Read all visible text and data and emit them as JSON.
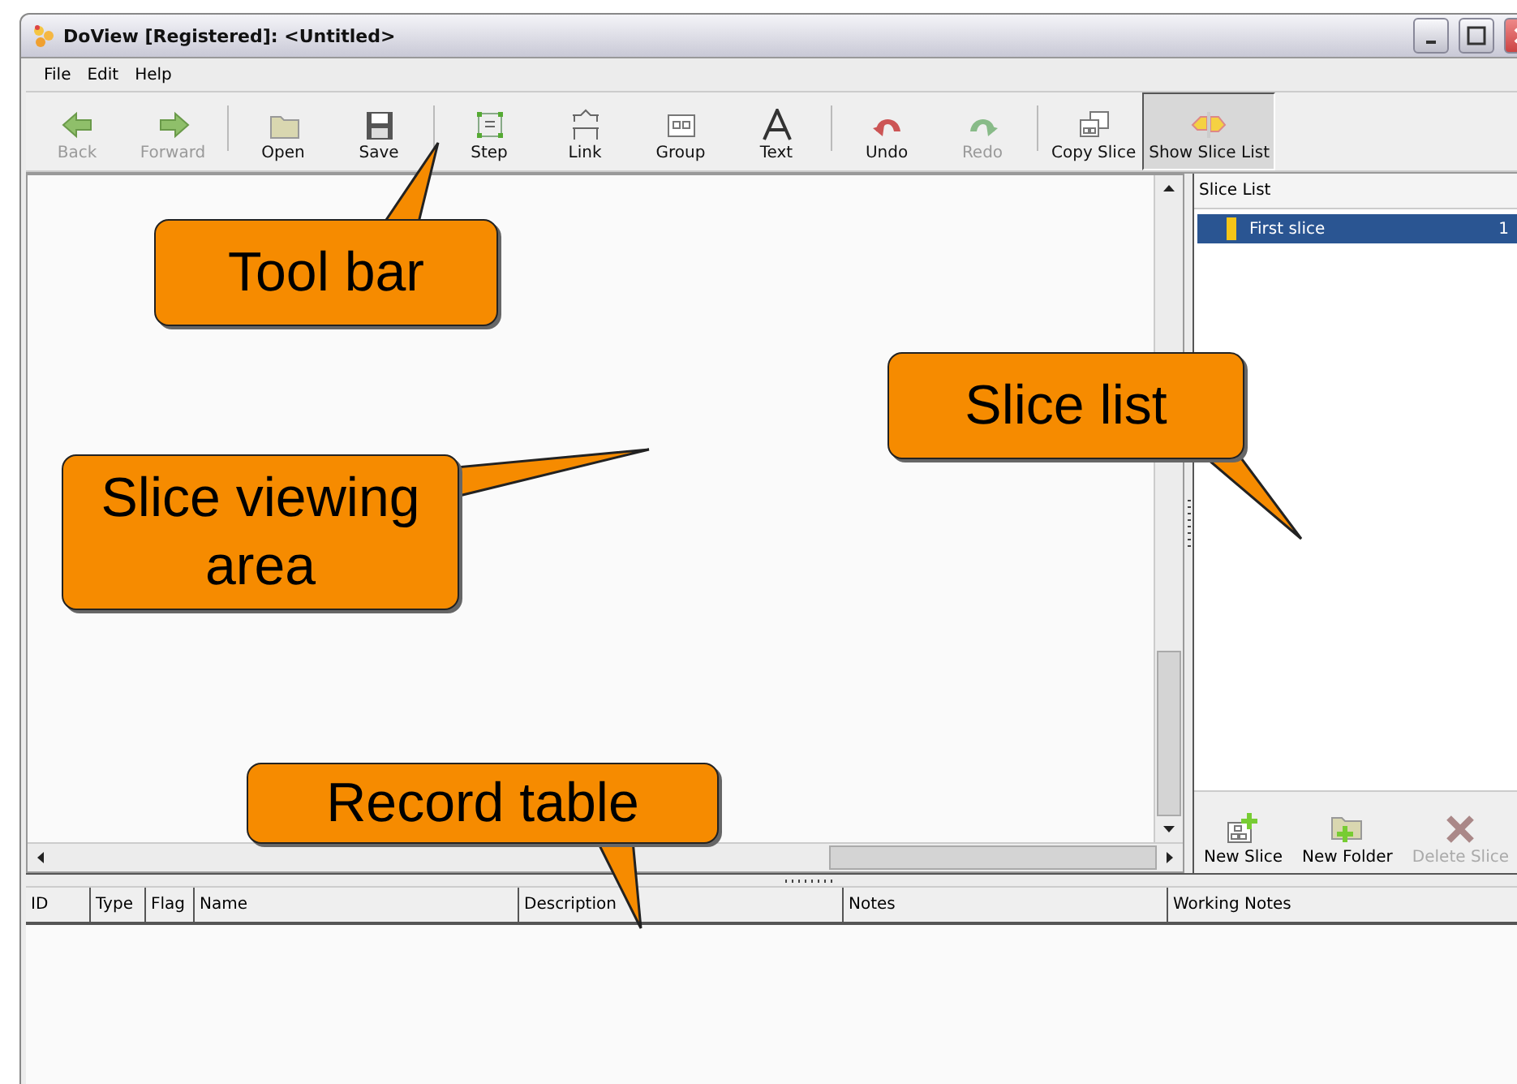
{
  "window": {
    "title": "DoView [Registered]: <Untitled>"
  },
  "menu": [
    {
      "label": "File"
    },
    {
      "label": "Edit"
    },
    {
      "label": "Help"
    }
  ],
  "toolbar": [
    {
      "kind": "button",
      "label": "Back",
      "disabled": true,
      "pressed": false
    },
    {
      "kind": "button",
      "label": "Forward",
      "disabled": true,
      "pressed": false
    },
    {
      "kind": "separator"
    },
    {
      "kind": "button",
      "label": "Open",
      "disabled": false,
      "pressed": false
    },
    {
      "kind": "button",
      "label": "Save",
      "disabled": false,
      "pressed": false
    },
    {
      "kind": "separator"
    },
    {
      "kind": "button",
      "label": "Step",
      "disabled": false,
      "pressed": false
    },
    {
      "kind": "button",
      "label": "Link",
      "disabled": false,
      "pressed": false
    },
    {
      "kind": "button",
      "label": "Group",
      "disabled": false,
      "pressed": false
    },
    {
      "kind": "button",
      "label": "Text",
      "disabled": false,
      "pressed": false
    },
    {
      "kind": "separator"
    },
    {
      "kind": "button",
      "label": "Undo",
      "disabled": false,
      "pressed": false
    },
    {
      "kind": "button",
      "label": "Redo",
      "disabled": true,
      "pressed": false
    },
    {
      "kind": "separator"
    },
    {
      "kind": "button",
      "label": "Copy Slice",
      "disabled": false,
      "pressed": false
    },
    {
      "kind": "button",
      "label": "Show Slice List",
      "disabled": false,
      "pressed": true
    }
  ],
  "slice_list": {
    "title": "Slice List",
    "items": [
      {
        "name": "First slice",
        "count": "1",
        "selected": true,
        "color": "#f5c518"
      }
    ],
    "buttons": [
      {
        "label": "New Slice",
        "disabled": false
      },
      {
        "label": "New Folder",
        "disabled": false
      },
      {
        "label": "Delete Slice",
        "disabled": true
      }
    ]
  },
  "record_table": {
    "columns": [
      "ID",
      "Type",
      "Flag",
      "Name",
      "Description",
      "Notes",
      "Working Notes"
    ]
  },
  "callouts": [
    {
      "text": "Tool bar"
    },
    {
      "text": "Slice list"
    },
    {
      "text": "Slice viewing area"
    },
    {
      "text": "Record table"
    }
  ]
}
